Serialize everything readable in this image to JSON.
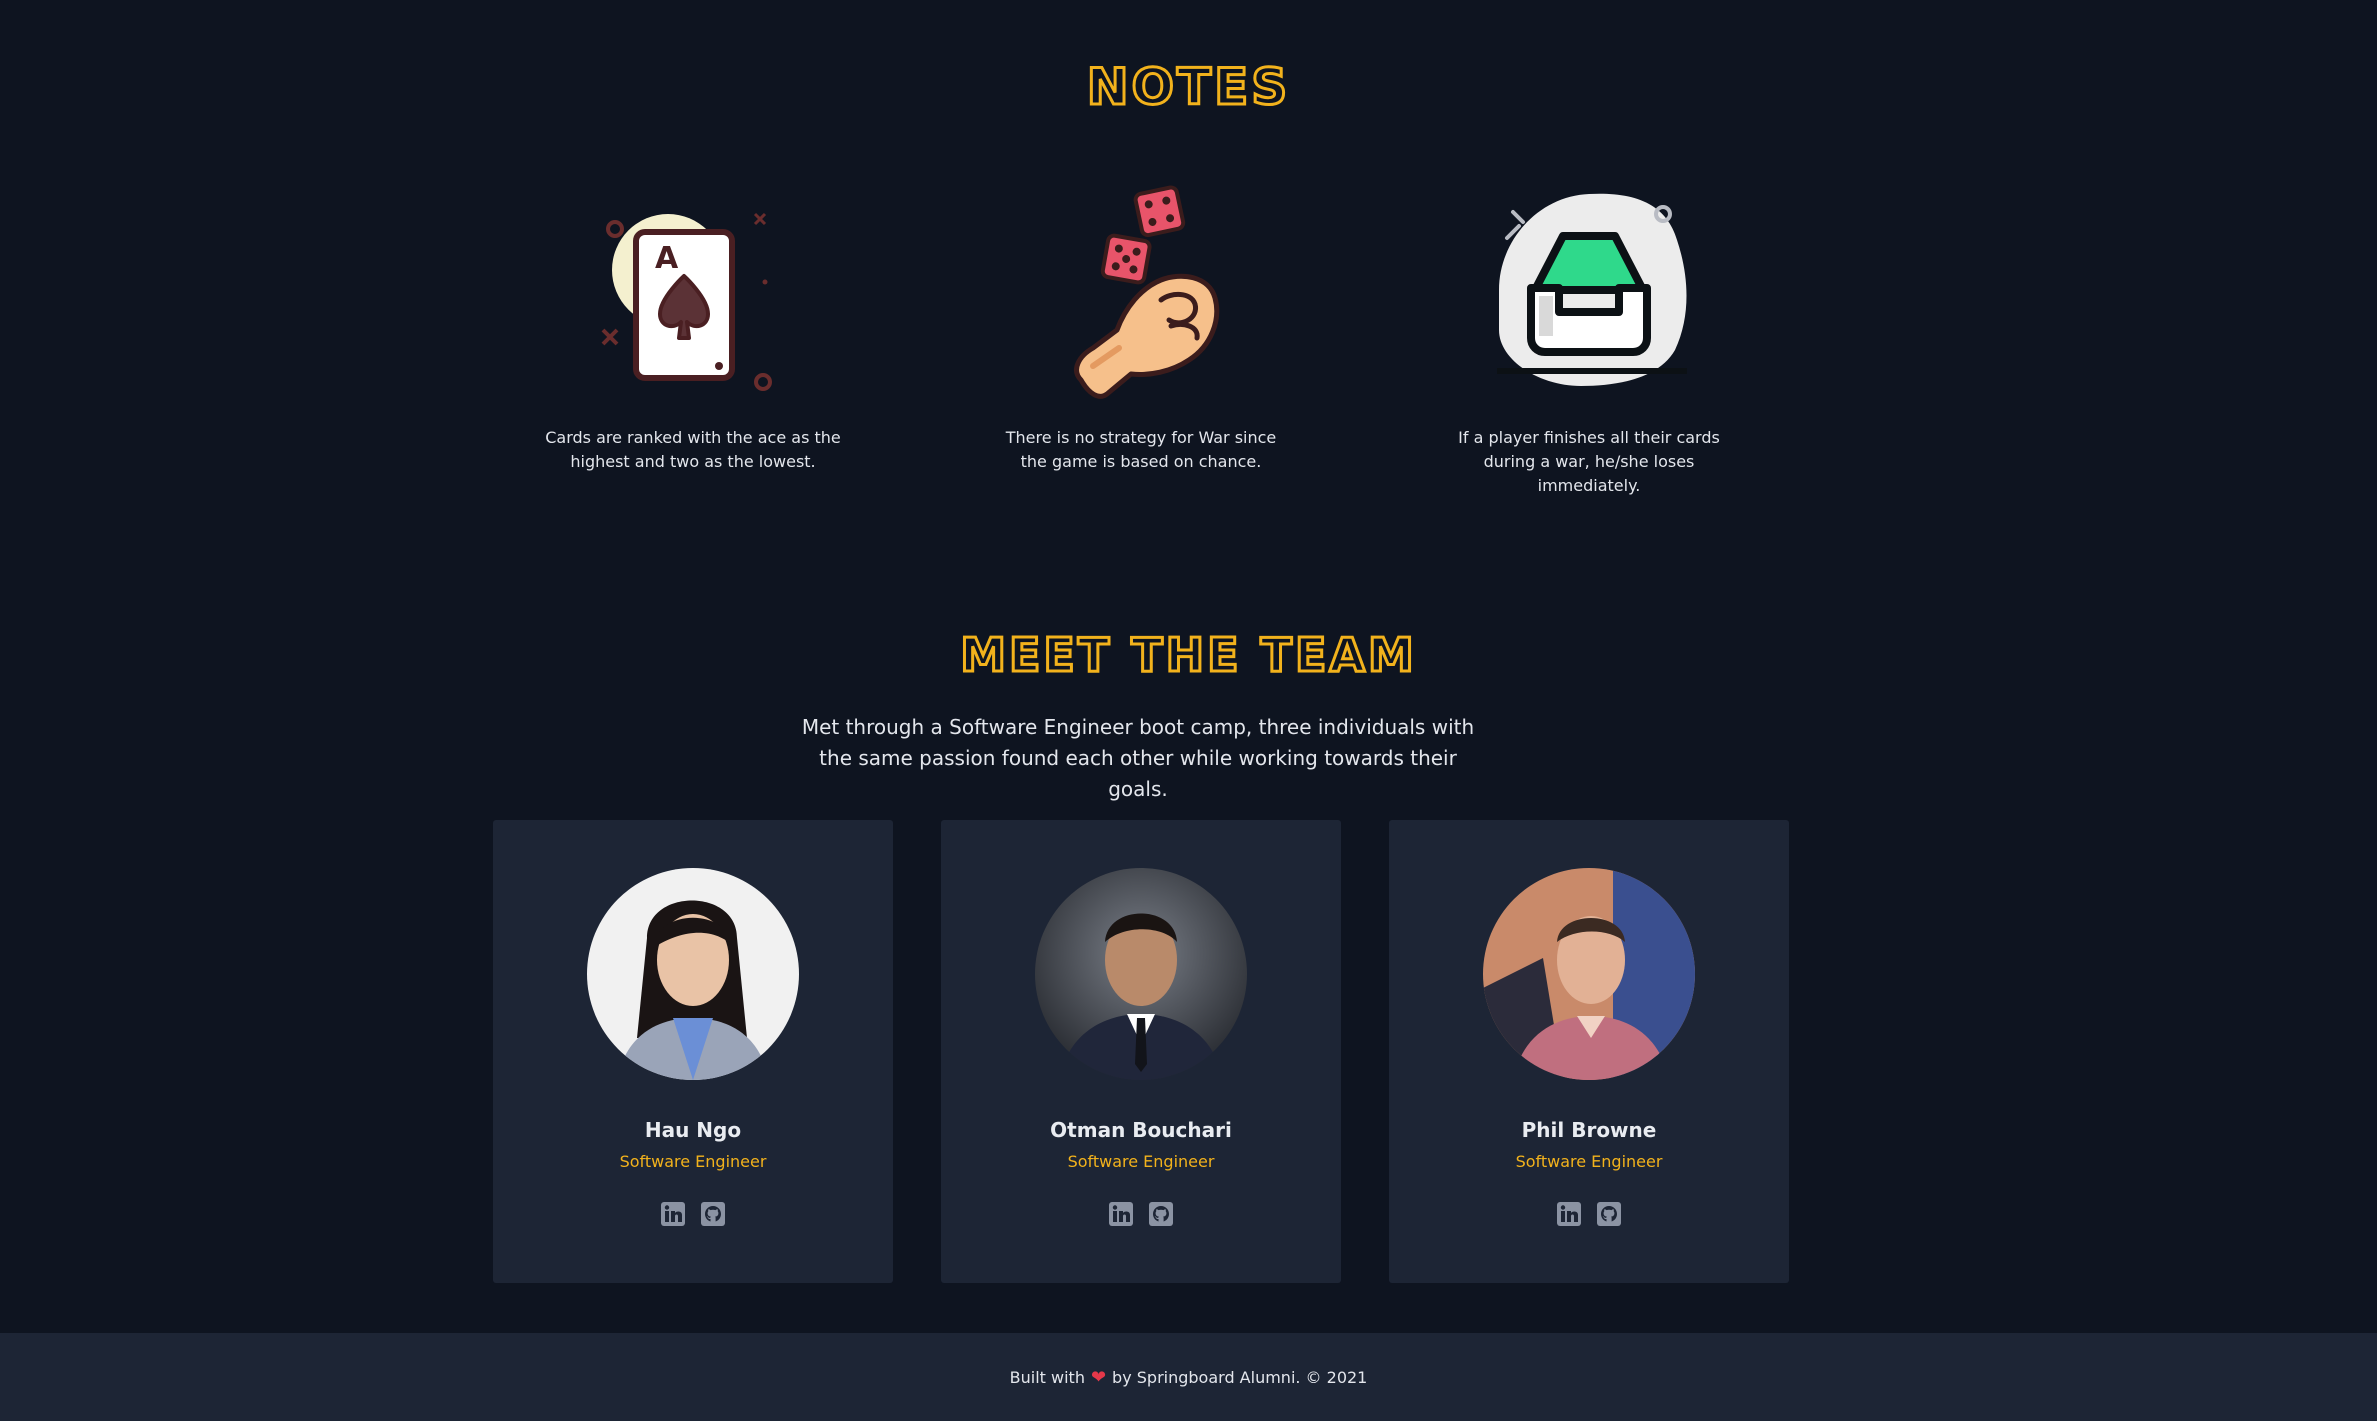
{
  "notes": {
    "title": "NOTES",
    "items": [
      {
        "icon": "ace-of-spades-card-icon",
        "text": "Cards are ranked with the ace as the highest and two as the lowest."
      },
      {
        "icon": "dice-hand-icon",
        "text": "There is no strategy for War since the game is based on chance."
      },
      {
        "icon": "empty-tray-icon",
        "text": "If a player finishes all their cards during a war, he/she loses immediately."
      }
    ]
  },
  "team": {
    "title": "MEET THE TEAM",
    "intro": "Met through a Software Engineer boot camp, three individuals with the same passion found each other while working towards their goals.",
    "members": [
      {
        "name": "Hau Ngo",
        "role": "Software Engineer"
      },
      {
        "name": "Otman Bouchari",
        "role": "Software Engineer"
      },
      {
        "name": "Phil Browne",
        "role": "Software Engineer"
      }
    ]
  },
  "footer": {
    "before": "Built with",
    "after": "by Springboard Alumni. © 2021"
  },
  "colors": {
    "background": "#0e1420",
    "card": "#1d2535",
    "accent": "#f2b21c",
    "heart": "#e5384a"
  }
}
